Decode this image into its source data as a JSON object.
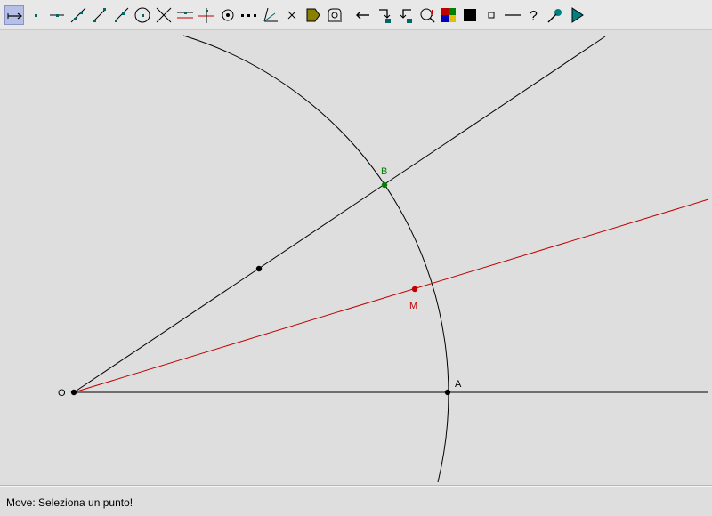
{
  "toolbar": {
    "tools": [
      {
        "name": "move-tool",
        "icon": "move-arrow-icon",
        "active": true
      },
      {
        "name": "point-tool",
        "icon": "point-icon"
      },
      {
        "name": "point-on-object-tool",
        "icon": "point-on-line-icon"
      },
      {
        "name": "line-tool",
        "icon": "line-icon"
      },
      {
        "name": "segment-tool",
        "icon": "segment-icon"
      },
      {
        "name": "ray-tool",
        "icon": "ray-icon"
      },
      {
        "name": "circle-tool",
        "icon": "circle-icon"
      },
      {
        "name": "intersection-tool",
        "icon": "intersection-icon"
      },
      {
        "name": "parallel-tool",
        "icon": "parallel-line-icon"
      },
      {
        "name": "perpendicular-tool",
        "icon": "perpendicular-line-icon"
      },
      {
        "name": "center-tool",
        "icon": "circle-center-icon"
      },
      {
        "name": "midpoint-tool",
        "icon": "midpoint-icon"
      },
      {
        "name": "angle-bisector-tool",
        "icon": "angle-bisector-icon"
      },
      {
        "name": "delete-tool",
        "icon": "cross-delete-icon"
      },
      {
        "name": "macro-tool",
        "icon": "macro-tag-icon"
      },
      {
        "name": "macro-run-tool",
        "icon": "macro-run-icon"
      },
      {
        "name": "undo-tool",
        "icon": "undo-arrow-icon"
      },
      {
        "name": "hide-tool",
        "icon": "hide-object-icon"
      },
      {
        "name": "show-tool",
        "icon": "show-object-icon"
      },
      {
        "name": "zoom-tool",
        "icon": "zoom-icon"
      },
      {
        "name": "color-tool",
        "icon": "color-palette-icon"
      },
      {
        "name": "fill-tool",
        "icon": "fill-square-icon"
      },
      {
        "name": "point-style-tool",
        "icon": "point-style-icon"
      },
      {
        "name": "line-style-tool",
        "icon": "line-style-icon"
      },
      {
        "name": "help-tool",
        "icon": "question-mark-icon"
      },
      {
        "name": "grab-tool",
        "icon": "grab-icon"
      },
      {
        "name": "play-tool",
        "icon": "play-triangle-icon"
      }
    ]
  },
  "geometry": {
    "points": {
      "O": {
        "label": "O",
        "color": "#000000"
      },
      "A": {
        "label": "A",
        "color": "#000000"
      },
      "B": {
        "label": "B",
        "color": "#008000"
      },
      "M": {
        "label": "M",
        "color": "#c00000"
      }
    },
    "colors": {
      "black": "#000000",
      "red": "#c00000",
      "green": "#008000"
    }
  },
  "status": {
    "text": "Move: Seleziona un punto!"
  }
}
